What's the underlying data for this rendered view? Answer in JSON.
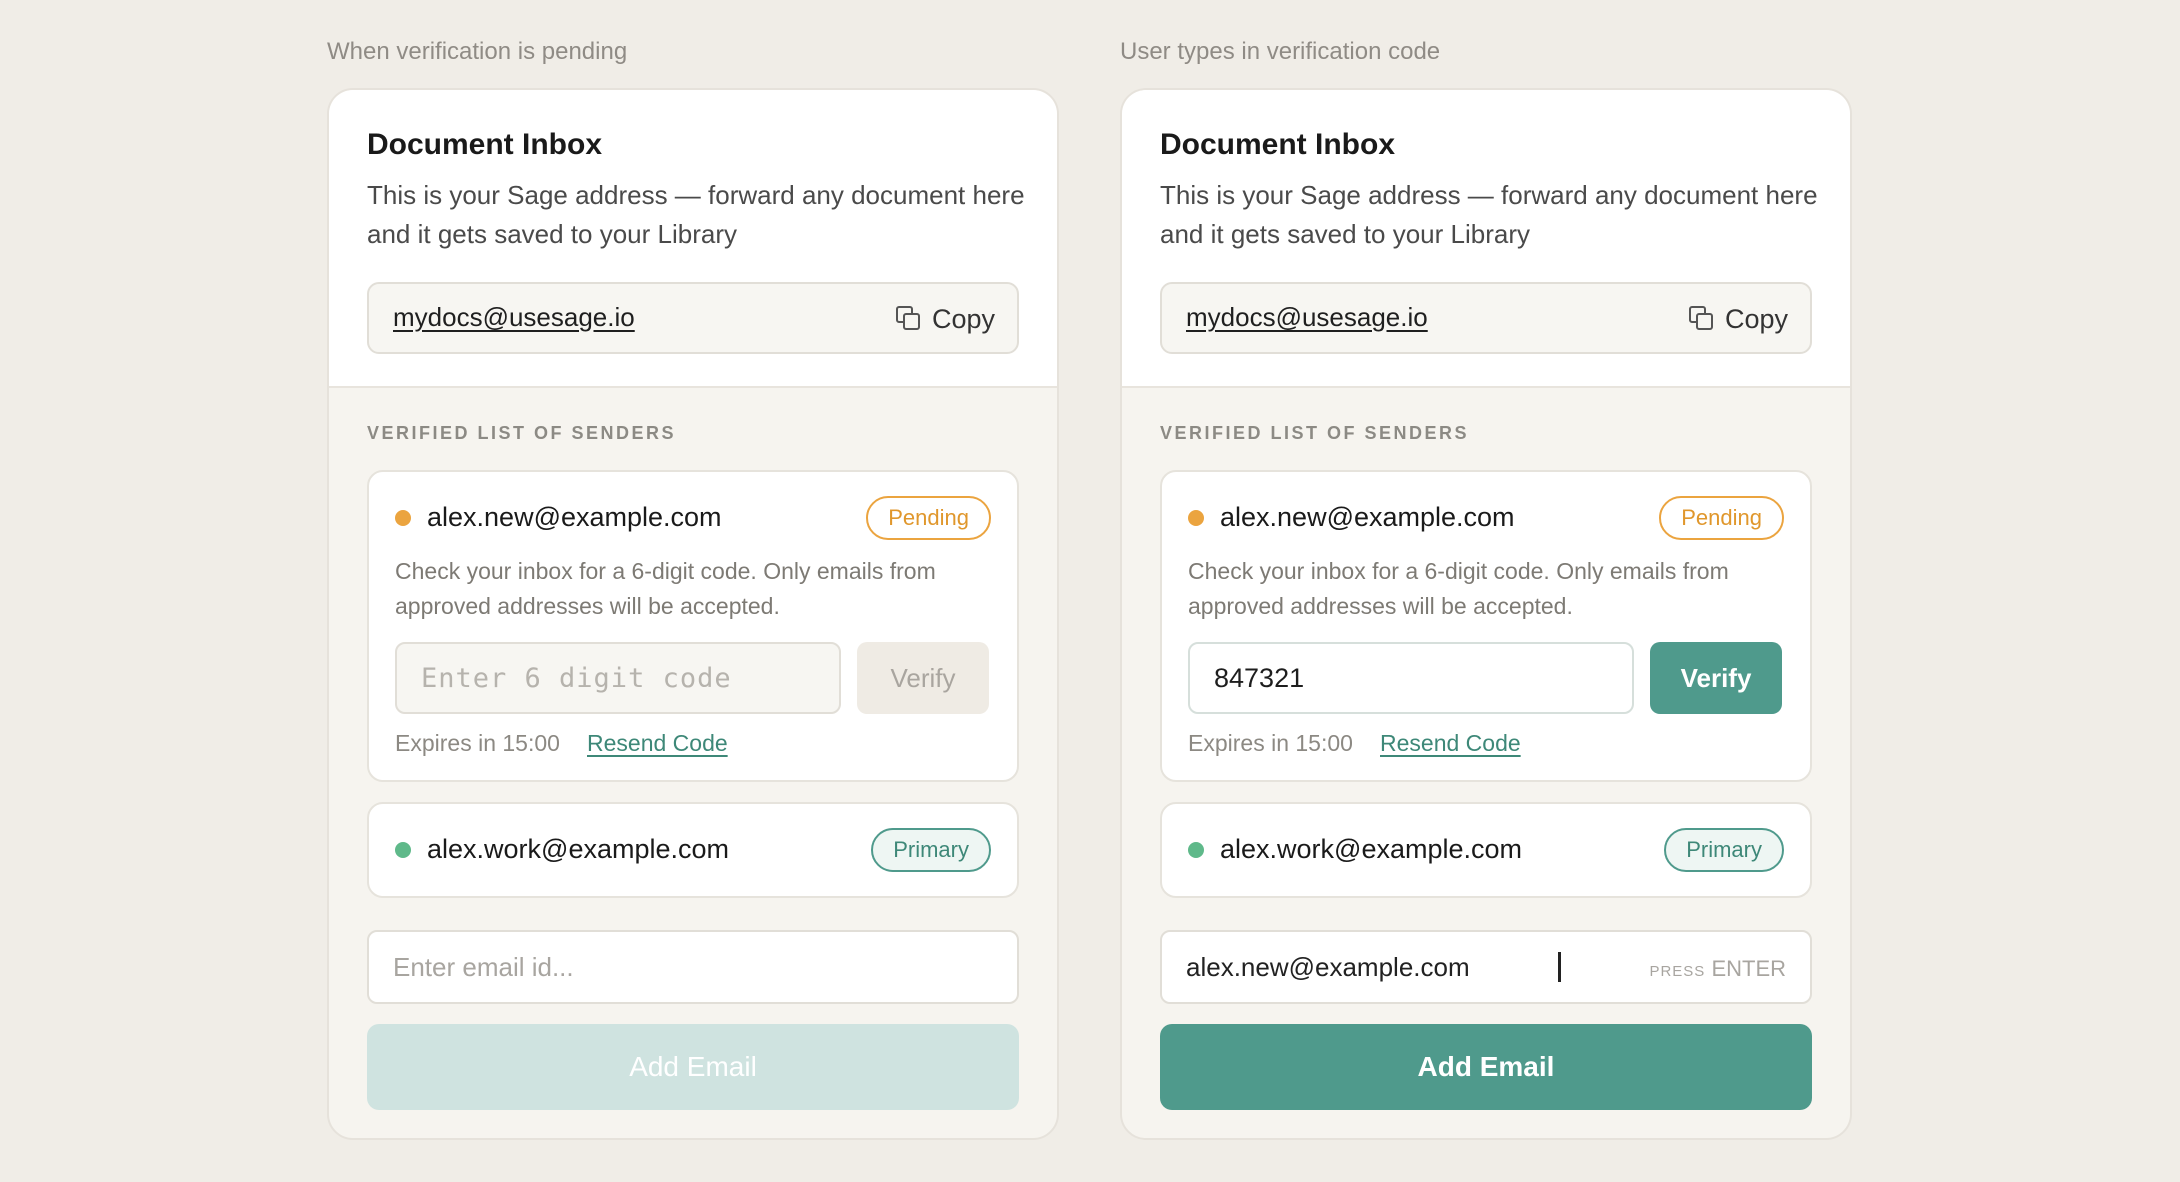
{
  "panels": [
    {
      "caption": "When verification is pending",
      "title": "Document Inbox",
      "description": "This is your Sage address — forward any document here and it gets saved to your Library",
      "address": "mydocs@usesage.io",
      "copy_label": "Copy",
      "section_label": "VERIFIED LIST OF SENDERS",
      "pending_sender": {
        "email": "alex.new@example.com",
        "badge": "Pending",
        "hint": "Check your inbox for a 6-digit code. Only emails from approved addresses will be accepted.",
        "code_placeholder": "Enter 6 digit code",
        "code_value": "",
        "verify_label": "Verify",
        "expires": "Expires in 15:00",
        "resend_label": "Resend Code"
      },
      "primary_sender": {
        "email": "alex.work@example.com",
        "badge": "Primary"
      },
      "email_input": {
        "placeholder": "Enter email id...",
        "value": ""
      },
      "add_label": "Add Email"
    },
    {
      "caption": "User types in verification code",
      "title": "Document Inbox",
      "description": "This is your Sage address — forward any document here and it gets saved to your Library",
      "address": "mydocs@usesage.io",
      "copy_label": "Copy",
      "section_label": "VERIFIED LIST OF SENDERS",
      "pending_sender": {
        "email": "alex.new@example.com",
        "badge": "Pending",
        "hint": "Check your inbox for a 6-digit code. Only emails from approved addresses will be accepted.",
        "code_placeholder": "",
        "code_value": "847321",
        "verify_label": "Verify",
        "expires": "Expires in 15:00",
        "resend_label": "Resend Code"
      },
      "primary_sender": {
        "email": "alex.work@example.com",
        "badge": "Primary"
      },
      "email_input": {
        "placeholder": "",
        "value": "alex.new@example.com",
        "press_hint_small": "PRESS",
        "press_hint_key": "ENTER"
      },
      "add_label": "Add Email"
    }
  ],
  "colors": {
    "accent": "#4f9a8c",
    "pending": "#eba43f",
    "primary_dot": "#5fb98a",
    "background": "#f0ede7"
  }
}
